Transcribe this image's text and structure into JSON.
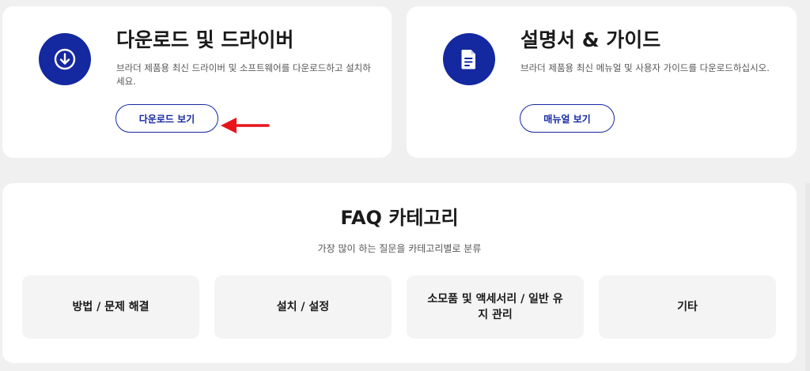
{
  "download_card": {
    "title": "다운로드 및 드라이버",
    "description": "브라더 제품용 최신 드라이버 및 소프트웨어를 다운로드하고 설치하세요.",
    "button_label": "다운로드 보기",
    "icon": "download-circle-icon"
  },
  "manual_card": {
    "title": "설명서 & 가이드",
    "description": "브라더 제품용 최신 메뉴얼 및 사용자 가이드를 다운로드하십시오.",
    "button_label": "매뉴얼 보기",
    "icon": "document-icon"
  },
  "faq": {
    "title": "FAQ 카테고리",
    "subtitle": "가장 많이 하는 질문을 카테고리별로 분류",
    "categories": [
      {
        "label": "방법 / 문제 해결"
      },
      {
        "label": "설치 / 설정"
      },
      {
        "label": "소모품 및 액세서리 / 일반 유지 관리"
      },
      {
        "label": "기타"
      }
    ]
  },
  "colors": {
    "brand": "#1428a0",
    "annotation_arrow": "#e8141c",
    "background": "#f0f0f0",
    "tile": "#f4f4f4"
  }
}
